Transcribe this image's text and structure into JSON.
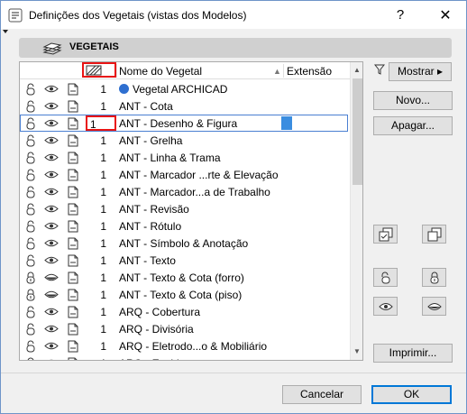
{
  "window": {
    "title": "Definições dos Vegetais (vistas dos Modelos)",
    "help_label": "?",
    "close_label": "✕"
  },
  "header": {
    "title": "VEGETAIS"
  },
  "columns": {
    "name": "Nome do Vegetal",
    "extension": "Extensão",
    "sort_indicator": "▲"
  },
  "rows": [
    {
      "pen": "1",
      "name": "Vegetal ARCHICAD",
      "has_logo": true,
      "selected": false
    },
    {
      "pen": "1",
      "name": "ANT - Cota"
    },
    {
      "pen": "1",
      "name": "ANT - Desenho & Figura",
      "selected": true
    },
    {
      "pen": "1",
      "name": "ANT - Grelha"
    },
    {
      "pen": "1",
      "name": "ANT - Linha & Trama"
    },
    {
      "pen": "1",
      "name": "ANT - Marcador ...rte & Elevação"
    },
    {
      "pen": "1",
      "name": "ANT - Marcador...a de Trabalho"
    },
    {
      "pen": "1",
      "name": "ANT - Revisão"
    },
    {
      "pen": "1",
      "name": "ANT - Rótulo"
    },
    {
      "pen": "1",
      "name": "ANT - Símbolo & Anotação"
    },
    {
      "pen": "1",
      "name": "ANT - Texto"
    },
    {
      "pen": "1",
      "name": "ANT - Texto & Cota (forro)",
      "locked": true,
      "hidden": true
    },
    {
      "pen": "1",
      "name": "ANT - Texto & Cota (piso)",
      "locked": true,
      "hidden": true
    },
    {
      "pen": "1",
      "name": "ARQ - Cobertura"
    },
    {
      "pen": "1",
      "name": "ARQ - Divisória"
    },
    {
      "pen": "1",
      "name": "ARQ - Eletrodo...o & Mobiliário"
    },
    {
      "pen": "1",
      "name": "ARQ - Enchimento"
    }
  ],
  "buttons": {
    "mostrar": "Mostrar ▸",
    "novo": "Novo...",
    "apagar": "Apagar...",
    "imprimir": "Imprimir...",
    "cancelar": "Cancelar",
    "ok": "OK"
  },
  "colors": {
    "accent": "#0078d7",
    "highlight_red": "#e81414",
    "selection_blue": "#3a8de0"
  }
}
